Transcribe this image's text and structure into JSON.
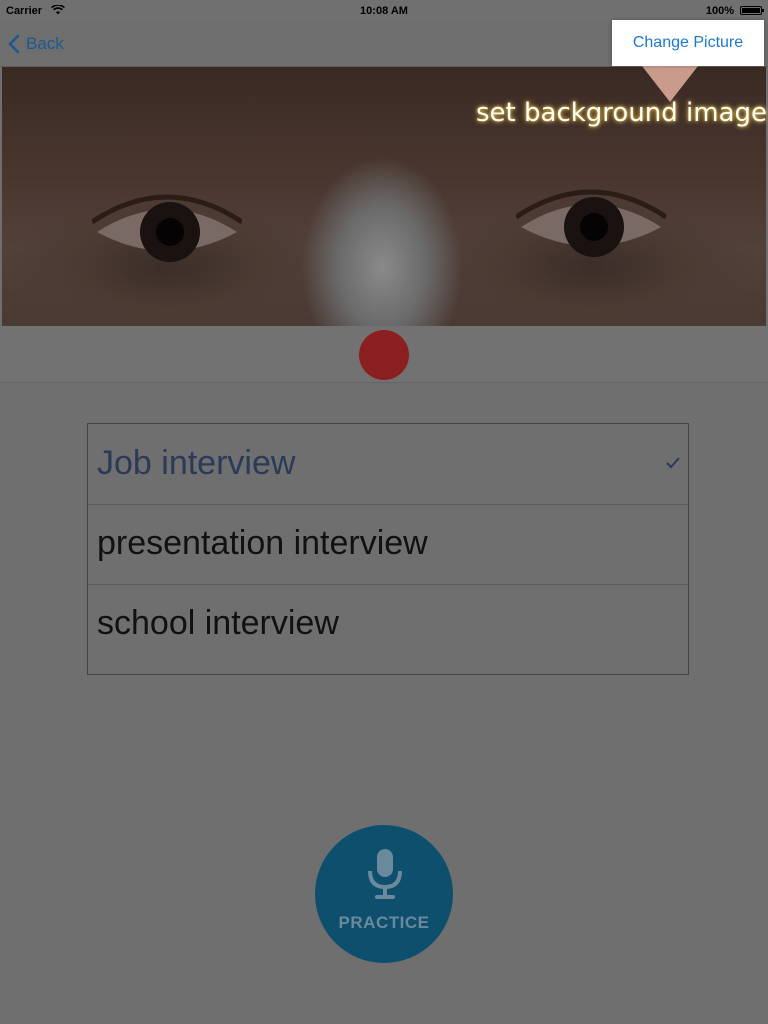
{
  "status_bar": {
    "carrier": "Carrier",
    "time": "10:08 AM",
    "battery": "100%"
  },
  "nav": {
    "back_label": "Back",
    "change_picture_label": "Change Picture"
  },
  "tooltip": {
    "text": "set background image"
  },
  "interview_types": [
    {
      "label": "Job interview",
      "selected": true
    },
    {
      "label": "presentation interview",
      "selected": false
    },
    {
      "label": "school interview",
      "selected": false
    }
  ],
  "practice": {
    "label": "PRACTICE"
  },
  "colors": {
    "accent_blue": "#1a7ad6",
    "record_red": "#8c1f1f",
    "practice_blue": "#0e4f6e",
    "overlay_gray": "#6f6f6f"
  }
}
